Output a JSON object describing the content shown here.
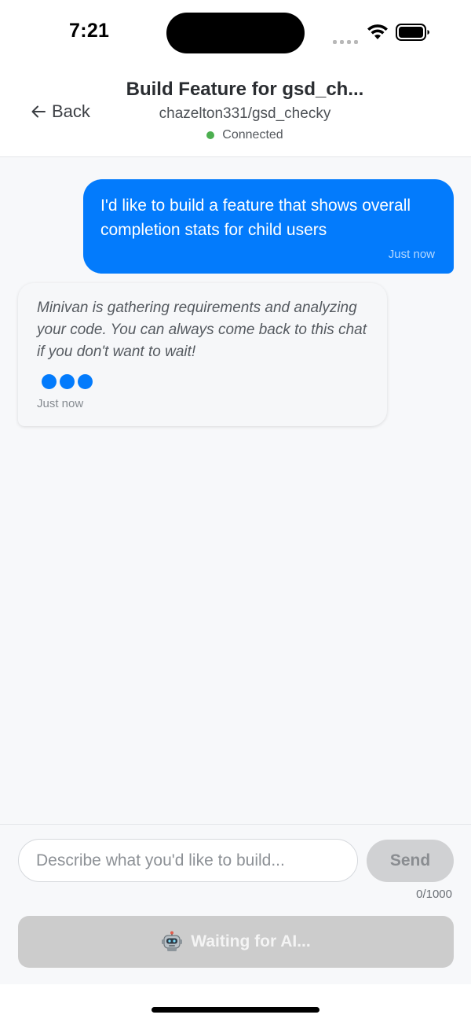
{
  "status_bar": {
    "time": "7:21",
    "icons": [
      "signal-icon",
      "wifi-icon",
      "battery-icon"
    ]
  },
  "header": {
    "back_label": "Back",
    "title": "Build Feature for gsd_ch...",
    "subtitle": "chazelton331/gsd_checky",
    "connection_status": "Connected",
    "connection_color": "#4caf50"
  },
  "chat": {
    "messages": [
      {
        "role": "user",
        "text": "I'd like to build a feature that shows overall completion stats for child users",
        "time": "Just now"
      },
      {
        "role": "assistant",
        "text": "Minivan is gathering requirements and analyzing your code. You can always come back to this chat if you don't want to wait!",
        "time": "Just now",
        "typing_indicator": true
      }
    ]
  },
  "composer": {
    "input_value": "",
    "placeholder": "Describe what you'd like to build...",
    "send_label": "Send",
    "char_count": "0/1000",
    "waiting_label": "Waiting for AI...",
    "waiting_icon": "robot-icon"
  },
  "colors": {
    "accent": "#037bfc",
    "user_bubble": "#037bfc",
    "disabled_button": "#cccccc",
    "chat_background": "#f7f8fa"
  }
}
